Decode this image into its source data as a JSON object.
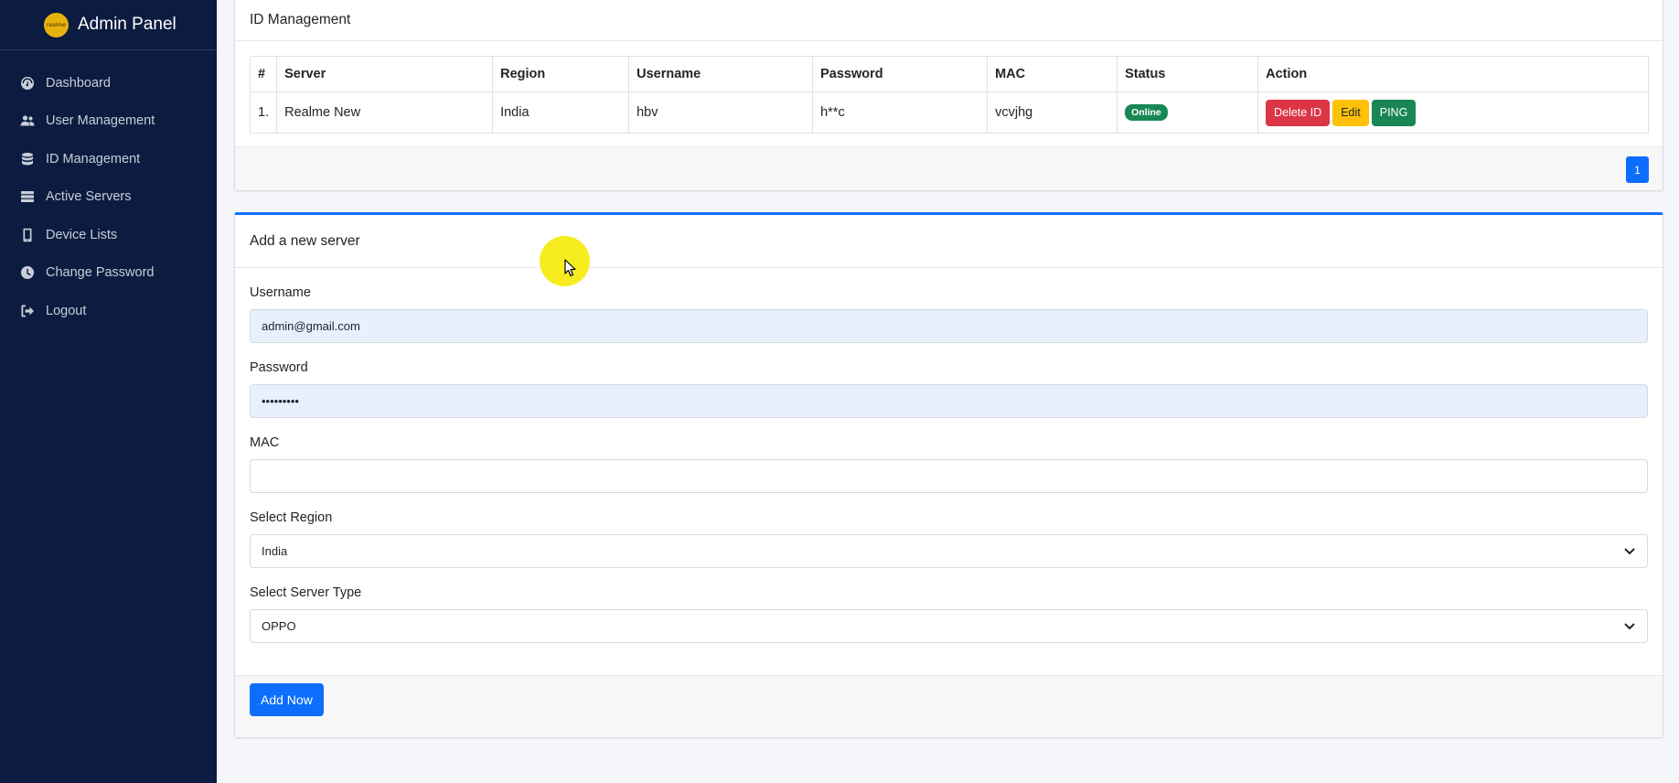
{
  "sidebar": {
    "brand_logo_text": "realme",
    "title": "Admin Panel",
    "items": [
      {
        "label": "Dashboard",
        "icon": "gauge-icon"
      },
      {
        "label": "User Management",
        "icon": "users-icon"
      },
      {
        "label": "ID Management",
        "icon": "database-icon"
      },
      {
        "label": "Active Servers",
        "icon": "server-icon"
      },
      {
        "label": "Device Lists",
        "icon": "mobile-icon"
      },
      {
        "label": "Change Password",
        "icon": "clock-icon"
      },
      {
        "label": "Logout",
        "icon": "logout-icon"
      }
    ]
  },
  "id_management": {
    "title": "ID Management",
    "columns": [
      "#",
      "Server",
      "Region",
      "Username",
      "Password",
      "MAC",
      "Status",
      "Action"
    ],
    "rows": [
      {
        "num": "1.",
        "server": "Realme New",
        "region": "India",
        "username": "hbv",
        "password": "h**c",
        "mac": "vcvjhg",
        "status": "Online"
      }
    ],
    "actions": {
      "delete": "Delete ID",
      "edit": "Edit",
      "ping": "PING"
    },
    "pagination": {
      "current": "1"
    }
  },
  "add_server": {
    "title": "Add a new server",
    "username_label": "Username",
    "username_value": "admin@gmail.com",
    "password_label": "Password",
    "password_value": "•••••••••",
    "mac_label": "MAC",
    "mac_value": "",
    "region_label": "Select Region",
    "region_value": "India",
    "server_type_label": "Select Server Type",
    "server_type_value": "OPPO",
    "submit_label": "Add Now"
  },
  "colors": {
    "sidebar_bg": "#0b1c40",
    "primary": "#0d6efd",
    "danger": "#dc3545",
    "warning": "#ffc107",
    "success": "#198754"
  }
}
